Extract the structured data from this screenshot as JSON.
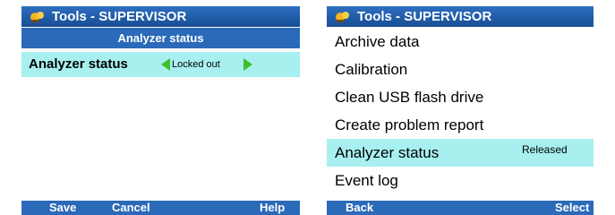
{
  "left_screen": {
    "title": "Tools - SUPERVISOR",
    "header": "Analyzer status",
    "status_row": {
      "label": "Analyzer status",
      "value": "Locked out"
    },
    "softkeys": {
      "left": "Save",
      "middle": "Cancel",
      "right": "Help"
    }
  },
  "right_screen": {
    "title": "Tools - SUPERVISOR",
    "menu_items": [
      {
        "label": "Archive data"
      },
      {
        "label": "Calibration"
      },
      {
        "label": "Clean USB flash drive"
      },
      {
        "label": "Create problem report"
      },
      {
        "label": "Analyzer status",
        "value": "Released",
        "selected": true
      },
      {
        "label": "Event log"
      }
    ],
    "softkeys": {
      "left": "Back",
      "right": "Select"
    }
  },
  "colors": {
    "title_bar": "#1f5aa6",
    "header_bar": "#2b6ab8",
    "selection": "#a8f0f0",
    "arrow": "#3fbf2a"
  },
  "icons": {
    "title_logo": "tools-logo-icon",
    "prev": "left-arrow-icon",
    "next": "right-arrow-icon"
  }
}
